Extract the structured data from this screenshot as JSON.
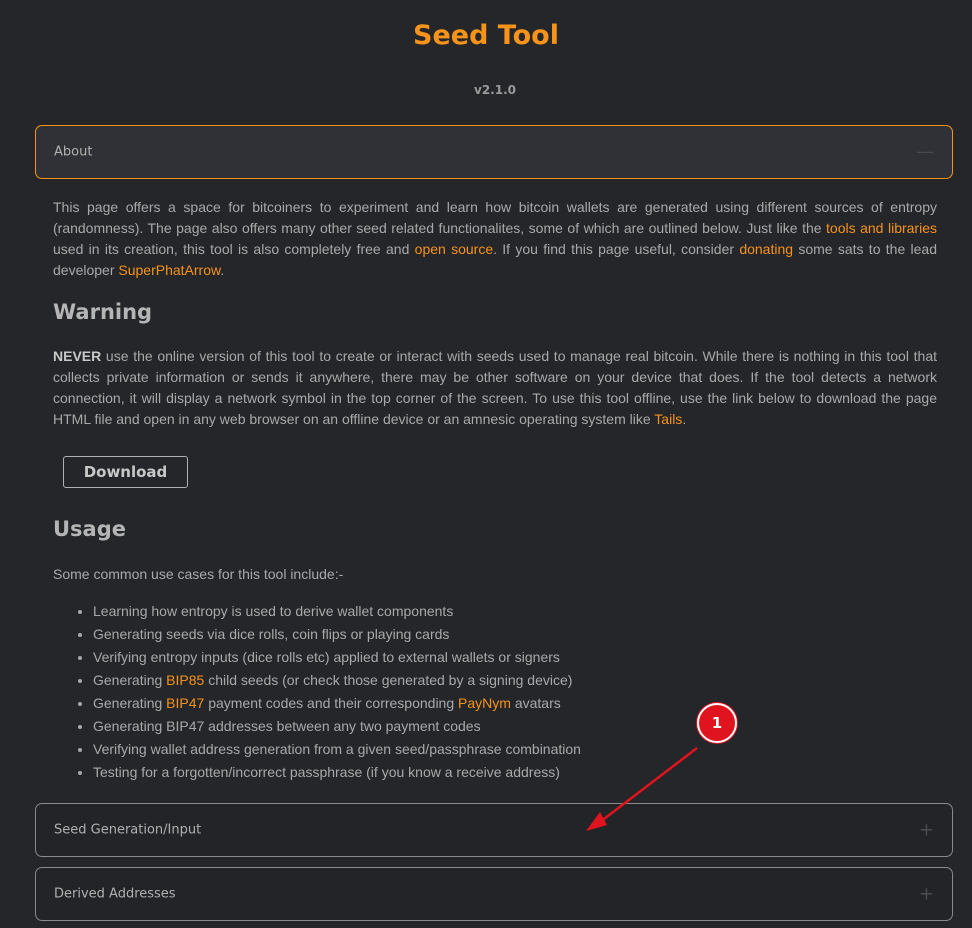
{
  "header": {
    "title": "Seed Tool",
    "version": "v2.1.0"
  },
  "about": {
    "label": "About",
    "toggle_icon": "minus-icon",
    "intro": {
      "t1": "This page offers a space for bitcoiners to experiment and learn how bitcoin wallets are generated using different sources of entropy (randomness). The page also offers many other seed related functionalites, some of which are outlined below. Just like the ",
      "link_tools": "tools and libraries",
      "t2": " used in its creation, this tool is also completely free and ",
      "link_open_source": "open source",
      "t3": ". If you find this page useful, consider ",
      "link_donating": "donating",
      "t4": " some sats to the lead developer ",
      "link_dev": "SuperPhatArrow",
      "t5": "."
    },
    "warning": {
      "heading": "Warning",
      "never": "NEVER",
      "t1": " use the online version of this tool to create or interact with seeds used to manage real bitcoin. While there is nothing in this tool that collects private information or sends it anywhere, there may be other software on your device that does. If the tool detects a network connection, it will display a network symbol in the top corner of the screen. To use this tool offline, use the link below to download the page HTML file and open in any web browser on an offline device or an amnesic operating system like ",
      "link_tails": "Tails",
      "t2": "."
    },
    "download_label": "Download",
    "usage": {
      "heading": "Usage",
      "intro": "Some common use cases for this tool include:-",
      "items": [
        {
          "pre": "Learning how entropy is used to derive wallet components"
        },
        {
          "pre": "Generating seeds via dice rolls, coin flips or playing cards"
        },
        {
          "pre": "Verifying entropy inputs (dice rolls etc) applied to external wallets or signers"
        },
        {
          "pre": "Generating ",
          "link": "BIP85",
          "post": " child seeds (or check those generated by a signing device)"
        },
        {
          "pre": "Generating ",
          "link": "BIP47",
          "mid": " payment codes and their corresponding ",
          "link2": "PayNym",
          "post": " avatars"
        },
        {
          "pre": "Generating BIP47 addresses between any two payment codes"
        },
        {
          "pre": "Verifying wallet address generation from a given seed/passphrase combination"
        },
        {
          "pre": "Testing for a forgotten/incorrect passphrase (if you know a receive address)"
        }
      ]
    }
  },
  "sections": [
    {
      "label": "Seed Generation/Input",
      "toggle_icon": "plus-icon"
    },
    {
      "label": "Derived Addresses",
      "toggle_icon": "plus-icon"
    }
  ],
  "annotation": {
    "marker_label": "1",
    "color": "#e0141e"
  },
  "colors": {
    "accent": "#f7931a",
    "background": "#24262a"
  }
}
